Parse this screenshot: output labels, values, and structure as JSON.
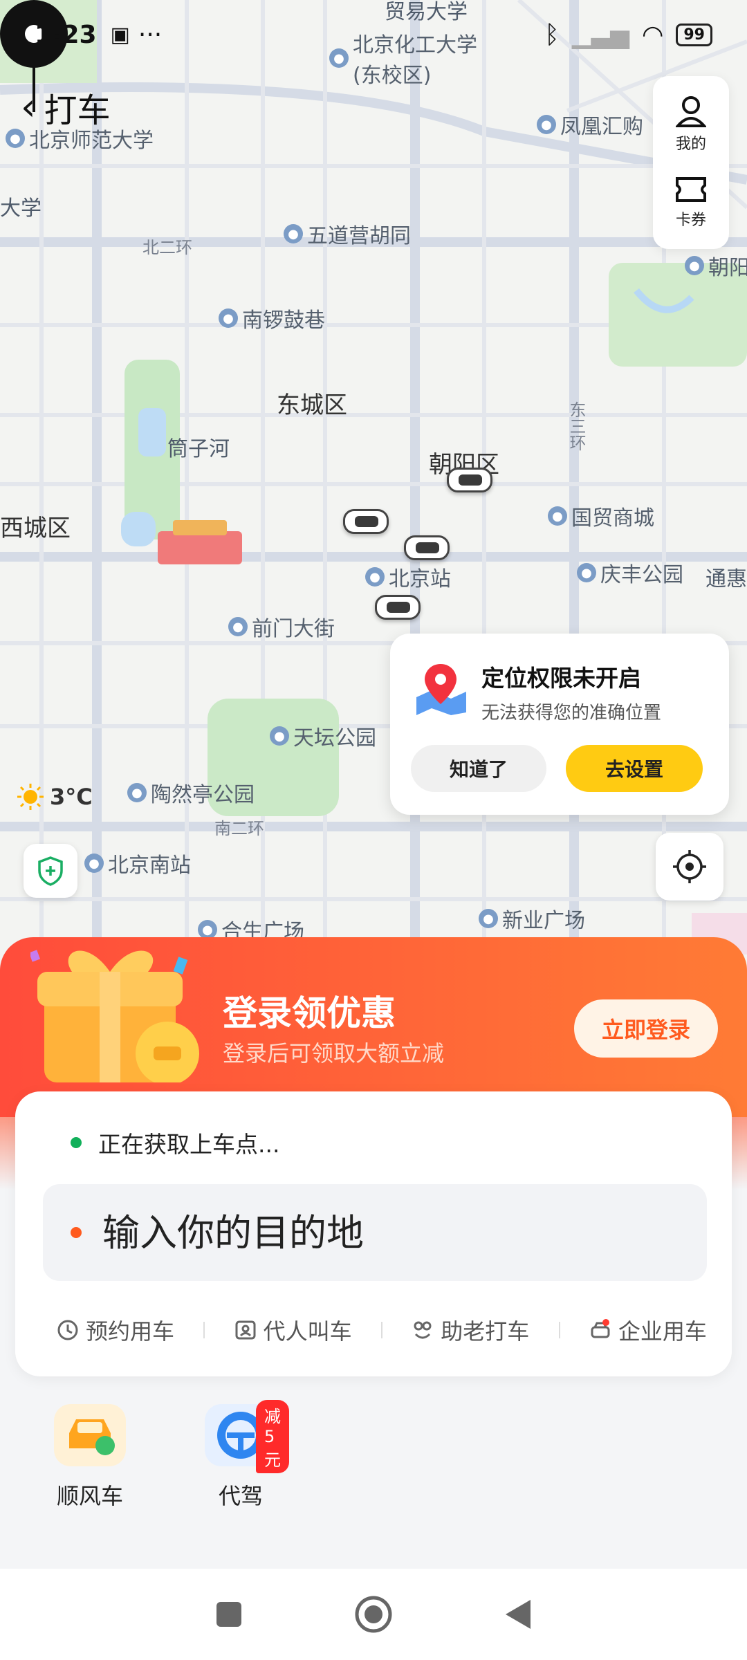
{
  "status": {
    "time": "1:23",
    "battery": "99"
  },
  "header": {
    "title": "打车"
  },
  "side": {
    "mine": "我的",
    "coupon": "卡券"
  },
  "map": {
    "districts": [
      "东城区",
      "朝阳区",
      "西城区"
    ],
    "roads": [
      "北二环",
      "南二环",
      "东三环"
    ],
    "pois": [
      "北京化工大学(东校区)",
      "北京师范大学",
      "大学",
      "凤凰汇购",
      "五道营胡同",
      "南锣鼓巷",
      "筒子河",
      "国贸商城",
      "北京站",
      "庆丰公园",
      "通惠",
      "前门大街",
      "天坛公园",
      "陶然亭公园",
      "北京南站",
      "合生广场",
      "新业广场",
      "朝阳"
    ],
    "top_text": "贸易大学"
  },
  "permission": {
    "title": "定位权限未开启",
    "subtitle": "无法获得您的准确位置",
    "dismiss": "知道了",
    "settings": "去设置"
  },
  "weather": {
    "temp": "3°C"
  },
  "promo": {
    "title": "登录领优惠",
    "subtitle": "登录后可领取大额立减",
    "button": "立即登录"
  },
  "order": {
    "pickup": "正在获取上车点...",
    "destination_placeholder": "输入你的目的地",
    "options": [
      "预约用车",
      "代人叫车",
      "助老打车",
      "企业用车"
    ]
  },
  "services": [
    {
      "label": "顺风车"
    },
    {
      "label": "代驾",
      "badge": "减5元"
    }
  ],
  "colors": {
    "accent": "#ffcb12",
    "promo": "#ff5a3a",
    "pickup_dot": "#11b05a",
    "dest_dot": "#ff5a1e"
  }
}
